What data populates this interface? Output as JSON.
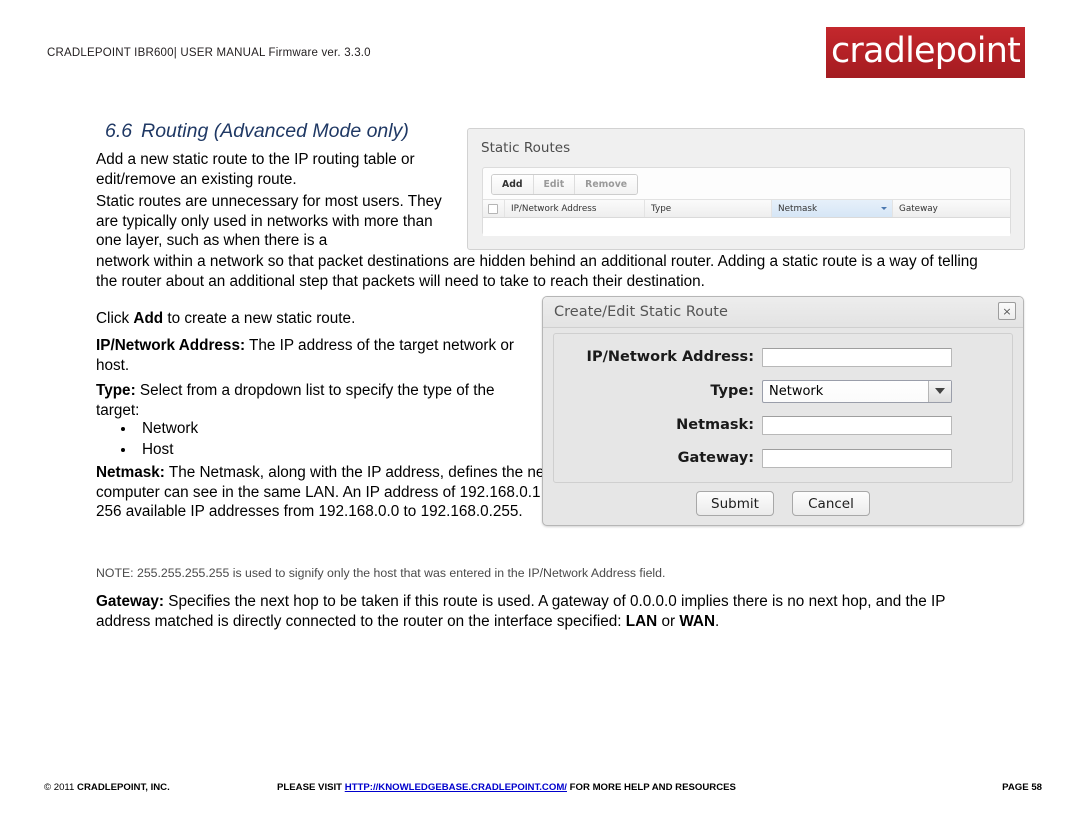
{
  "header": {
    "title": "CRADLEPOINT IBR600| USER MANUAL Firmware ver. 3.3.0",
    "logo_text": "cradlepoint",
    "logo_color": "#b32025"
  },
  "section": {
    "number": "6.6",
    "heading": "Routing (Advanced Mode only)",
    "heading_color": "#1f3864"
  },
  "body": {
    "intro1": "Add a new static route to the IP routing table or edit/remove an existing route.",
    "intro2": "Static routes are unnecessary for most users. They are typically only used in networks with more than one layer, such as when there is a",
    "wrap": "network within a network so that packet destinations are hidden behind an additional router. Adding a static route is a way of telling the router about an additional step that packets will need to take to reach their destination.",
    "click_add_pre": "Click ",
    "click_add_bold": "Add",
    "click_add_post": " to create a new static route.",
    "ip_label": "IP/Network Address:",
    "ip_desc": " The IP address of the target network or host.",
    "type_label": "Type:",
    "type_desc": " Select from a dropdown list to specify the type of the target:",
    "type_options": [
      "Network",
      "Host"
    ],
    "netmask_label": "Netmask:",
    "netmask_desc": " The Netmask, along with the IP address, defines the network the computer belongs to and which other IP addresses the computer can see in the same LAN. An IP address of 192.168.0.1 along with a Netmask of 255.255.255.0 defines a network with 256 available IP addresses from 192.168.0.0 to 192.168.0.255.",
    "note": "NOTE: 255.255.255.255 is used to signify only the host that was entered in the IP/Network Address field.",
    "gateway_label": "Gateway:",
    "gateway_desc_1": " Specifies the next hop to be taken if this route is used. A gateway of 0.0.0.0 implies there is no next hop, and the IP address matched is directly connected to the router on the interface specified: ",
    "gateway_lan": "LAN",
    "gateway_or": " or ",
    "gateway_wan": "WAN",
    "gateway_end": "."
  },
  "static_routes_panel": {
    "title": "Static Routes",
    "toolbar": [
      {
        "label": "Add",
        "enabled": true
      },
      {
        "label": "Edit",
        "enabled": false
      },
      {
        "label": "Remove",
        "enabled": false
      }
    ],
    "columns": [
      "IP/Network Address",
      "Type",
      "Netmask",
      "Gateway"
    ],
    "sorted_column": "Netmask",
    "sorted_column_color": "#d6e6f6",
    "rows": []
  },
  "dialog": {
    "title": "Create/Edit Static Route",
    "close_icon": "×",
    "fields": [
      {
        "label": "IP/Network Address:",
        "value": "",
        "kind": "text"
      },
      {
        "label": "Type:",
        "value": "Network",
        "kind": "select"
      },
      {
        "label": "Netmask:",
        "value": "",
        "kind": "text"
      },
      {
        "label": "Gateway:",
        "value": "",
        "kind": "text"
      }
    ],
    "submit_label": "Submit",
    "cancel_label": "Cancel"
  },
  "footer": {
    "copyright_symbol": "© 2011 ",
    "company": "CRADLEPOINT, INC.",
    "please_visit": "PLEASE VISIT ",
    "link": "HTTP://KNOWLEDGEBASE.CRADLEPOINT.COM/",
    "after_link": " FOR MORE HELP AND RESOURCES",
    "page": "PAGE 58"
  }
}
